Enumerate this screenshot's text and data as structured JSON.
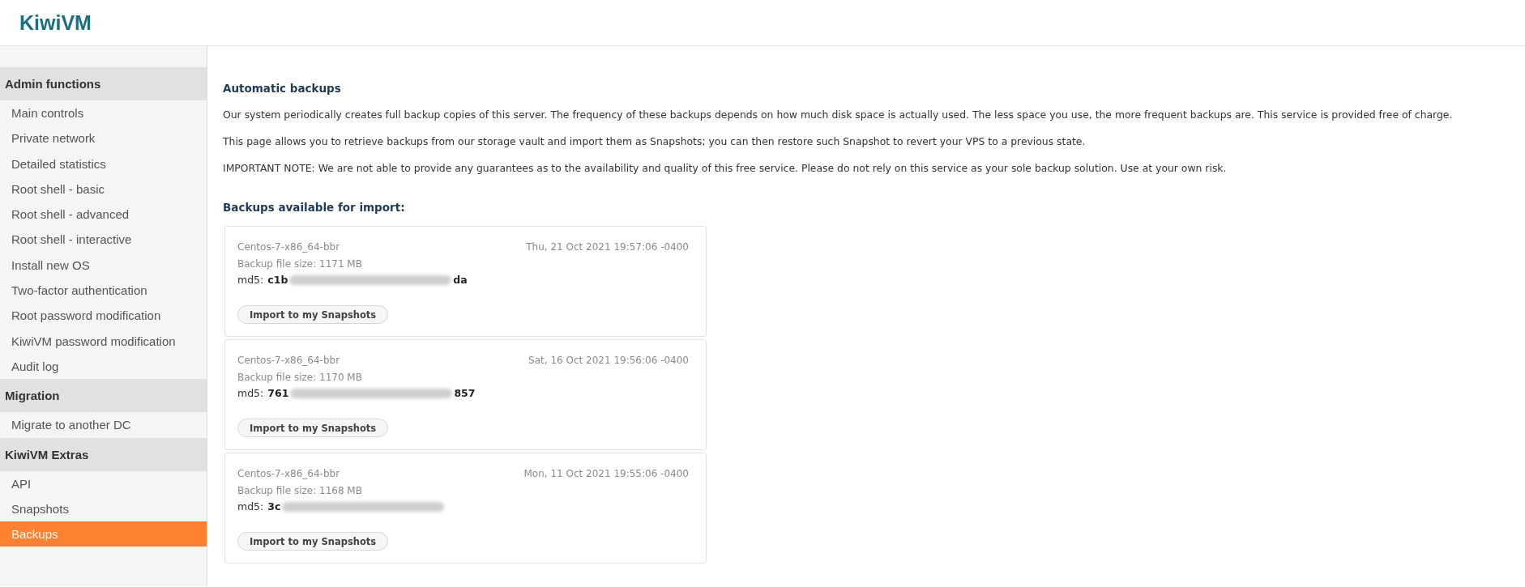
{
  "header": {
    "logo": "KiwiVM"
  },
  "sidebar": {
    "groups": [
      {
        "title": "Admin functions",
        "items": [
          {
            "label": "Main controls",
            "selected": false
          },
          {
            "label": "Private network",
            "selected": false
          },
          {
            "label": "Detailed statistics",
            "selected": false
          },
          {
            "label": "Root shell - basic",
            "selected": false
          },
          {
            "label": "Root shell - advanced",
            "selected": false
          },
          {
            "label": "Root shell - interactive",
            "selected": false
          },
          {
            "label": "Install new OS",
            "selected": false
          },
          {
            "label": "Two-factor authentication",
            "selected": false
          },
          {
            "label": "Root password modification",
            "selected": false
          },
          {
            "label": "KiwiVM password modification",
            "selected": false
          },
          {
            "label": "Audit log",
            "selected": false
          }
        ]
      },
      {
        "title": "Migration",
        "items": [
          {
            "label": "Migrate to another DC",
            "selected": false
          }
        ]
      },
      {
        "title": "KiwiVM Extras",
        "items": [
          {
            "label": "API",
            "selected": false
          },
          {
            "label": "Snapshots",
            "selected": false
          },
          {
            "label": "Backups",
            "selected": true
          }
        ]
      }
    ]
  },
  "main": {
    "title": "Automatic backups",
    "paragraphs": [
      "Our system periodically creates full backup copies of this server. The frequency of these backups depends on how much disk space is actually used. The less space you use, the more frequent backups are. This service is provided free of charge.",
      "This page allows you to retrieve backups from our storage vault and import them as Snapshots; you can then restore such Snapshot to revert your VPS to a previous state.",
      "IMPORTANT NOTE: We are not able to provide any guarantees as to the availability and quality of this free service. Please do not rely on this service as your sole backup solution. Use at your own risk."
    ],
    "backups_title": "Backups available for import:",
    "backups": [
      {
        "name": "Centos-7-x86_64-bbr",
        "date": "Thu, 21 Oct 2021 19:57:06 -0400",
        "size": "Backup file size: 1171 MB",
        "md5_label": "md5:",
        "md5_start": "c1b",
        "md5_end": "da",
        "redacted": true,
        "button": "Import to my Snapshots"
      },
      {
        "name": "Centos-7-x86_64-bbr",
        "date": "Sat, 16 Oct 2021 19:56:06 -0400",
        "size": "Backup file size: 1170 MB",
        "md5_label": "md5:",
        "md5_start": "761",
        "md5_end": "857",
        "redacted": true,
        "button": "Import to my Snapshots"
      },
      {
        "name": "Centos-7-x86_64-bbr",
        "date": "Mon, 11 Oct 2021 19:55:06 -0400",
        "size": "Backup file size: 1168 MB",
        "md5_label": "md5:",
        "md5_start": "3c",
        "redacted": true,
        "button": "Import to my Snapshots"
      }
    ]
  }
}
